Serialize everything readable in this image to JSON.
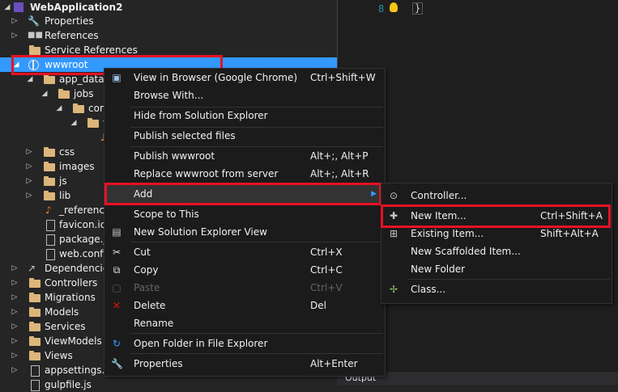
{
  "explorer": {
    "rows": [
      {
        "label": "WebApplication2",
        "icon": "csharp-project-icon",
        "expanded": true
      },
      {
        "label": "Properties",
        "icon": "wrench-icon"
      },
      {
        "label": "References",
        "icon": "references-icon"
      },
      {
        "label": "Service References",
        "icon": "folder-icon"
      },
      {
        "label": "wwwroot",
        "icon": "globe-icon",
        "selected": true
      },
      {
        "label": "app_data",
        "icon": "folder-icon"
      },
      {
        "label": "jobs",
        "icon": "folder-icon"
      },
      {
        "label": "con",
        "icon": "folder-icon"
      },
      {
        "label": "t",
        "icon": "folder-icon"
      },
      {
        "label": "",
        "icon": "file-icon"
      },
      {
        "label": "css",
        "icon": "folder-icon"
      },
      {
        "label": "images",
        "icon": "folder-icon"
      },
      {
        "label": "js",
        "icon": "folder-icon"
      },
      {
        "label": "lib",
        "icon": "folder-icon"
      },
      {
        "label": "_reference",
        "icon": "file-icon"
      },
      {
        "label": "favicon.ico",
        "icon": "file-icon"
      },
      {
        "label": "package.js",
        "icon": "file-icon"
      },
      {
        "label": "web.config",
        "icon": "file-icon"
      },
      {
        "label": "Dependencies",
        "icon": "dependencies-icon"
      },
      {
        "label": "Controllers",
        "icon": "folder-icon"
      },
      {
        "label": "Migrations",
        "icon": "folder-icon"
      },
      {
        "label": "Models",
        "icon": "folder-icon"
      },
      {
        "label": "Services",
        "icon": "folder-icon"
      },
      {
        "label": "ViewModels",
        "icon": "folder-icon"
      },
      {
        "label": "Views",
        "icon": "folder-icon"
      },
      {
        "label": "appsettings.js",
        "icon": "file-icon"
      },
      {
        "label": "gulpfile.js",
        "icon": "file-icon"
      }
    ]
  },
  "editor": {
    "line_number": "8",
    "code": "}"
  },
  "output_tab": "Output",
  "context_menu": {
    "items": [
      {
        "label": "View in Browser (Google Chrome)",
        "shortcut": "Ctrl+Shift+W",
        "icon": "browser-icon"
      },
      {
        "label": "Browse With...",
        "shortcut": ""
      },
      {
        "label": "Hide from Solution Explorer",
        "shortcut": ""
      },
      {
        "label": "Publish selected files",
        "shortcut": ""
      },
      {
        "label": "Publish wwwroot",
        "shortcut": "Alt+;, Alt+P"
      },
      {
        "label": "Replace wwwroot from server",
        "shortcut": "Alt+;, Alt+R"
      },
      {
        "label": "Add",
        "shortcut": "",
        "submenu": true
      },
      {
        "label": "Scope to This",
        "shortcut": ""
      },
      {
        "label": "New Solution Explorer View",
        "shortcut": "",
        "icon": "new-view-icon"
      },
      {
        "label": "Cut",
        "shortcut": "Ctrl+X",
        "icon": "cut-icon"
      },
      {
        "label": "Copy",
        "shortcut": "Ctrl+C",
        "icon": "copy-icon"
      },
      {
        "label": "Paste",
        "shortcut": "Ctrl+V",
        "icon": "paste-icon",
        "disabled": true
      },
      {
        "label": "Delete",
        "shortcut": "Del",
        "icon": "delete-icon"
      },
      {
        "label": "Rename",
        "shortcut": ""
      },
      {
        "label": "Open Folder in File Explorer",
        "shortcut": "",
        "icon": "open-folder-icon"
      },
      {
        "label": "Properties",
        "shortcut": "Alt+Enter",
        "icon": "properties-icon"
      }
    ]
  },
  "submenu": {
    "items": [
      {
        "label": "Controller...",
        "shortcut": "",
        "icon": "controller-icon"
      },
      {
        "label": "New Item...",
        "shortcut": "Ctrl+Shift+A",
        "icon": "new-item-icon"
      },
      {
        "label": "Existing Item...",
        "shortcut": "Shift+Alt+A",
        "icon": "existing-item-icon"
      },
      {
        "label": "New Scaffolded Item...",
        "shortcut": ""
      },
      {
        "label": "New Folder",
        "shortcut": ""
      },
      {
        "label": "Class...",
        "shortcut": "",
        "icon": "class-icon"
      }
    ]
  },
  "colors": {
    "selection": "#3399ff",
    "highlight_box": "#e81123",
    "menu_bg": "#1b1b1c",
    "panel_bg": "#252526"
  }
}
